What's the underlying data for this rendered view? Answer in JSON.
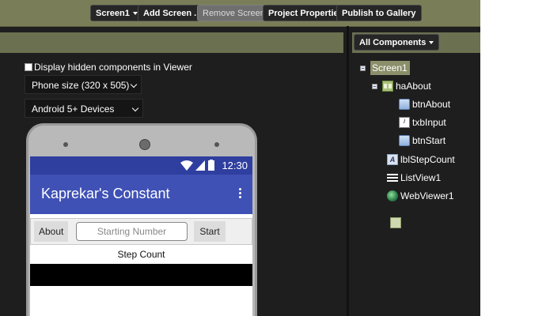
{
  "toolbar": {
    "screen_select": "Screen1",
    "add_screen": "Add Screen ...",
    "remove_screen": "Remove Screen",
    "project_properties": "Project Properties",
    "publish": "Publish to Gallery"
  },
  "viewer": {
    "hidden_label": "Display hidden components in Viewer",
    "phone_size": "Phone size (320 x 505)",
    "device": "Android 5+ Devices"
  },
  "phone": {
    "time": "12:30",
    "app_title": "Kaprekar's Constant",
    "btn_about": "About",
    "input_placeholder": "Starting Number",
    "btn_start": "Start",
    "step_count": "Step Count"
  },
  "components": {
    "header": "All Components",
    "tree": [
      {
        "name": "Screen1",
        "type": "screen",
        "selected": true
      },
      {
        "name": "haAbout",
        "type": "horizontal-arrangement"
      },
      {
        "name": "btnAbout",
        "type": "button"
      },
      {
        "name": "txbInput",
        "type": "textbox"
      },
      {
        "name": "btnStart",
        "type": "button"
      },
      {
        "name": "lblStepCount",
        "type": "label"
      },
      {
        "name": "ListView1",
        "type": "listview"
      },
      {
        "name": "WebViewer1",
        "type": "webviewer"
      }
    ]
  },
  "colors": {
    "toolbar_bg": "#7a7e58",
    "workspace_bg": "#1e1e1e",
    "app_primary": "#3f51b5",
    "status_bar": "#2f3f9f"
  }
}
